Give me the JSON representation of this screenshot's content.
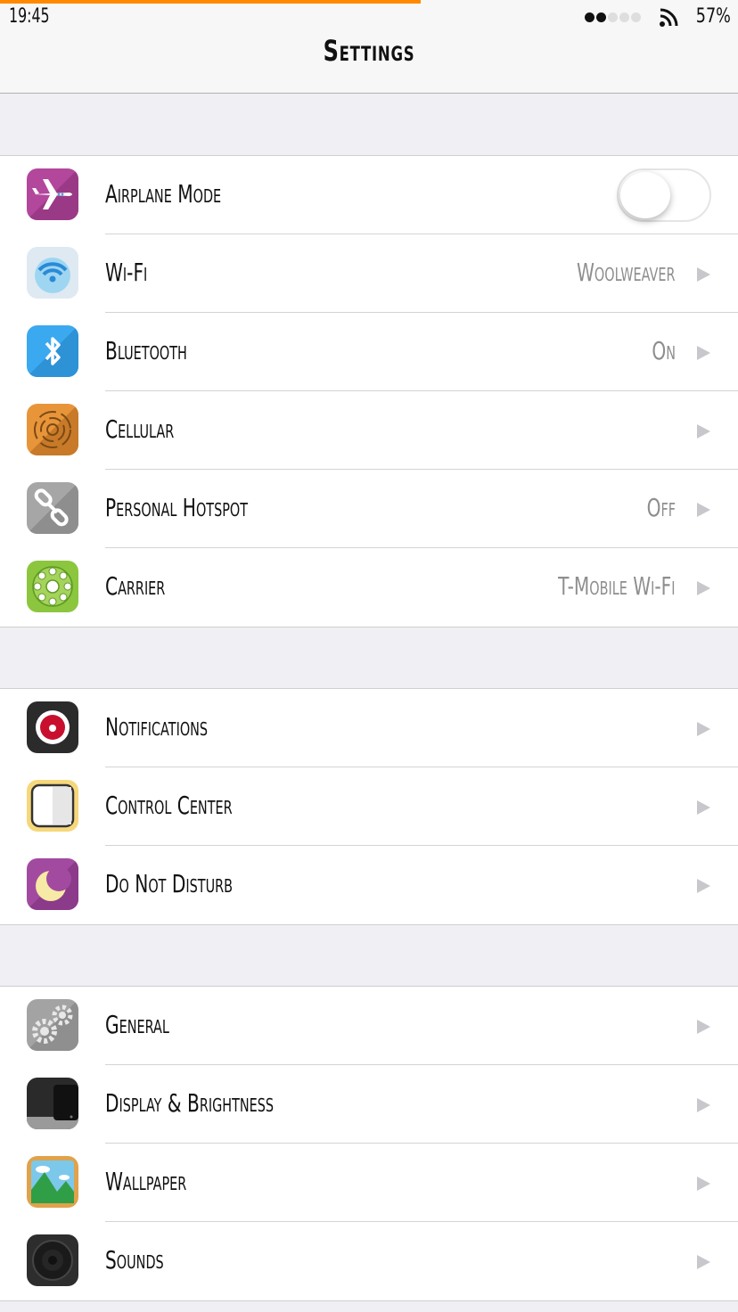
{
  "status": {
    "time": "19:45",
    "battery": "57%",
    "signal_bars_filled": 2,
    "signal_bars_total": 5,
    "loading_progress": 0.57
  },
  "nav": {
    "title": "Settings"
  },
  "groups": [
    {
      "rows": [
        {
          "label": "Airplane Mode",
          "icon": "airplane-icon",
          "toggle": false
        },
        {
          "label": "Wi-Fi",
          "icon": "wifi-icon",
          "value": "Woolweaver"
        },
        {
          "label": "Bluetooth",
          "icon": "bluetooth-icon",
          "value": "On"
        },
        {
          "label": "Cellular",
          "icon": "cellular-icon",
          "value": ""
        },
        {
          "label": "Personal Hotspot",
          "icon": "hotspot-chain-icon",
          "value": "Off"
        },
        {
          "label": "Carrier",
          "icon": "carrier-dial-icon",
          "value": "T-Mobile Wi-Fi"
        }
      ]
    },
    {
      "rows": [
        {
          "label": "Notifications",
          "icon": "notifications-icon"
        },
        {
          "label": "Control Center",
          "icon": "control-center-icon"
        },
        {
          "label": "Do Not Disturb",
          "icon": "moon-icon"
        }
      ]
    },
    {
      "rows": [
        {
          "label": "General",
          "icon": "gears-icon"
        },
        {
          "label": "Display & Brightness",
          "icon": "display-icon"
        },
        {
          "label": "Wallpaper",
          "icon": "wallpaper-icon"
        },
        {
          "label": "Sounds",
          "icon": "speaker-icon"
        }
      ]
    }
  ],
  "colors": {
    "progress": "#ff8a00",
    "background": "#efeff4",
    "chevron": "#c7c7cc"
  }
}
